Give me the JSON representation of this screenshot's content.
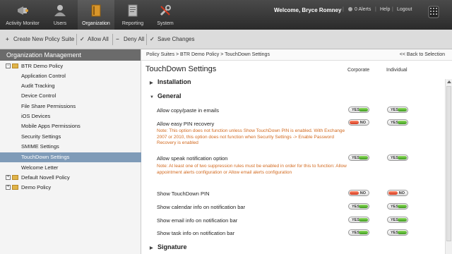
{
  "colors": {
    "topbar": "#333333",
    "selected": "#7f9bb8",
    "note": "#d2691e",
    "yes": "#3c9a1e",
    "no": "#d2381e"
  },
  "nav": [
    {
      "label": "Activity Monitor",
      "icon": "megaphone-icon"
    },
    {
      "label": "Users",
      "icon": "user-icon"
    },
    {
      "label": "Organization",
      "icon": "binder-icon",
      "active": true
    },
    {
      "label": "Reporting",
      "icon": "report-icon"
    },
    {
      "label": "System",
      "icon": "wrench-icon"
    }
  ],
  "header": {
    "welcome": "Welcome, Bryce Romney",
    "alerts": "0 Alerts",
    "sep": "|",
    "help": "Help",
    "logout": "Logout"
  },
  "toolbar": {
    "create": "Create New Policy Suite",
    "allow_all": "Allow All",
    "deny_all": "Deny All",
    "save": "Save Changes"
  },
  "sidebar": {
    "title": "Organization Management",
    "items": [
      {
        "label": "BTR Demo Policy",
        "type": "folder",
        "expanded": true
      },
      {
        "label": "Application Control"
      },
      {
        "label": "Audit Tracking"
      },
      {
        "label": "Device Control"
      },
      {
        "label": "File Share Permissions"
      },
      {
        "label": "iOS Devices"
      },
      {
        "label": "Mobile Apps Permissions"
      },
      {
        "label": "Security Settings"
      },
      {
        "label": "SMIME Settings"
      },
      {
        "label": "TouchDown Settings",
        "selected": true
      },
      {
        "label": "Welcome Letter"
      },
      {
        "label": "Default Novell Policy",
        "type": "folder"
      },
      {
        "label": "Demo Policy",
        "type": "folder"
      }
    ]
  },
  "main": {
    "breadcrumb": "Policy Suites > BTR Demo Policy > TouchDown Settings",
    "back": "<< Back to Selection",
    "title": "TouchDown Settings",
    "col_corporate": "Corporate",
    "col_individual": "Individual",
    "sec_installation": "Installation",
    "sec_general": "General",
    "sec_signature": "Signature",
    "settings": [
      {
        "label": "Allow copy/paste in emails",
        "corporate": "YES",
        "individual": "YES"
      },
      {
        "label": "Allow easy PIN recovery",
        "corporate": "NO",
        "individual": "YES",
        "note": "Note: This option does not function unless Show TouchDown PIN is enabled. With Exchange 2007 or 2010, this option does not function when Security Settings -> Enable Password Recovery is enabled"
      },
      {
        "label": "Allow speak notification option",
        "corporate": "YES",
        "individual": "YES",
        "note": "Note: At least one of two suppression rules must be enabled in order for this to function: Allow appointment alerts configuration or Allow email alerts configuration"
      },
      {
        "label": "Show TouchDown PIN",
        "corporate": "NO",
        "individual": "NO"
      },
      {
        "label": "Show calendar info on notification bar",
        "corporate": "YES",
        "individual": "YES"
      },
      {
        "label": "Show email info on notification bar",
        "corporate": "YES",
        "individual": "YES"
      },
      {
        "label": "Show task info on notification bar",
        "corporate": "YES",
        "individual": "YES"
      }
    ]
  }
}
